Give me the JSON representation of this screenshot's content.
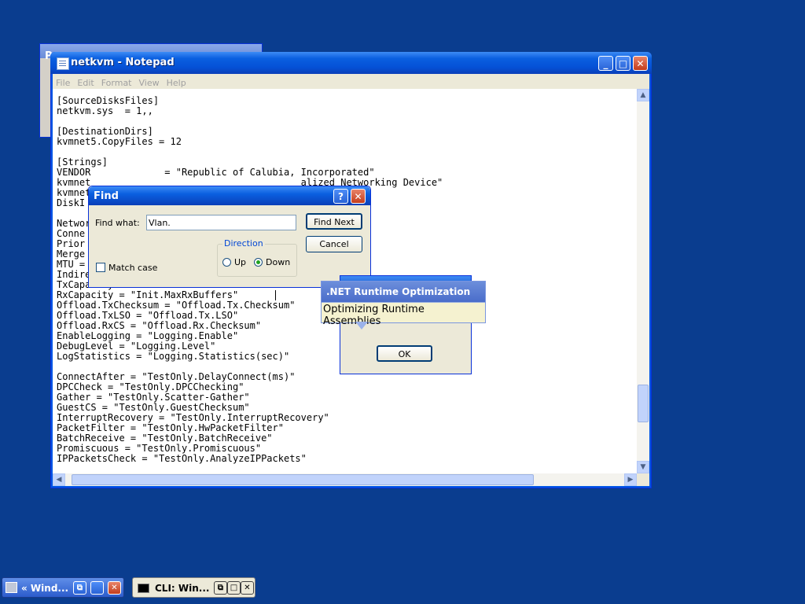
{
  "desktop_color": "#0a3d8f",
  "back_window": {
    "title": "P"
  },
  "notepad": {
    "title": "netkvm - Notepad",
    "menu": [
      "File",
      "Edit",
      "Format",
      "View",
      "Help"
    ],
    "content": "[SourceDisksFiles]\nnetkvm.sys  = 1,,\n\n[DestinationDirs]\nkvmnet5.CopyFiles = 12\n\n[Strings]\nVENDOR             = \"Republic of Calubia, Incorporated\"\nkvmnet                                     alized Networking Device\"\nkvmnet\nDiskI\n\nNetwor\nConne\nPrior\nMerge\nMTU =\nIndire\nTxCapacity = \"Init.MaxTxBuffers\"\nRxCapacity = \"Init.MaxRxBuffers\"\nOffload.TxChecksum = \"Offload.Tx.Checksum\"\nOffload.TxLSO = \"Offload.Tx.LSO\"\nOffload.RxCS = \"Offload.Rx.Checksum\"\nEnableLogging = \"Logging.Enable\"\nDebugLevel = \"Logging.Level\"\nLogStatistics = \"Logging.Statistics(sec)\"\n\nConnectAfter = \"TestOnly.DelayConnect(ms)\"\nDPCCheck = \"TestOnly.DPCChecking\"\nGather = \"TestOnly.Scatter-Gather\"\nGuestCS = \"TestOnly.GuestChecksum\"\nInterruptRecovery = \"TestOnly.InterruptRecovery\"\nPacketFilter = \"TestOnly.HwPacketFilter\"\nBatchReceive = \"TestOnly.BatchReceive\"\nPromiscuous = \"TestOnly.Promiscuous\"\nIPPacketsCheck = \"TestOnly.AnalyzeIPPackets\""
  },
  "find_dialog": {
    "title": "Find",
    "help_glyph": "?",
    "close_glyph": "✕",
    "find_what_label": "Find what:",
    "find_what_value": "Vlan.",
    "find_next_label": "Find Next",
    "cancel_label": "Cancel",
    "direction_label": "Direction",
    "up_label": "Up",
    "down_label": "Down",
    "direction_selected": "Down",
    "match_case_label": "Match case",
    "match_case_checked": false
  },
  "message_box": {
    "ok_label": "OK"
  },
  "tooltip": {
    "title": ".NET Runtime Optimization",
    "text": "Optimizing Runtime Assemblies"
  },
  "taskbar": [
    {
      "label": "« Wind...",
      "icon": "window-icon"
    },
    {
      "label": "CLI: Win...",
      "icon": "console-icon"
    }
  ],
  "title_buttons": {
    "minimize": "_",
    "maximize": "□",
    "close": "✕"
  }
}
